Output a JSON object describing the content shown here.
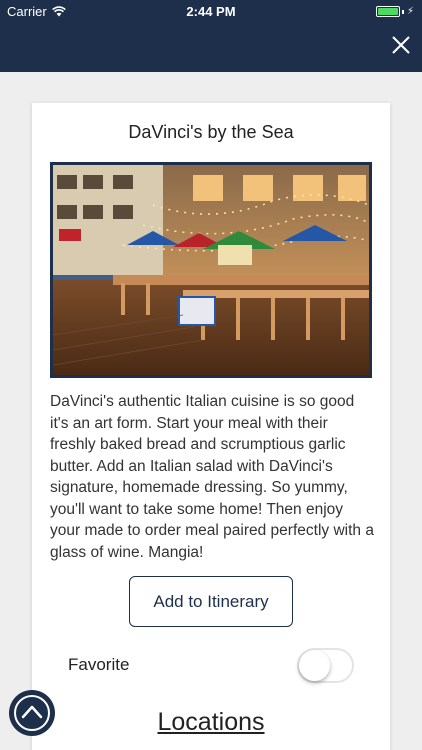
{
  "status_bar": {
    "carrier": "Carrier",
    "time": "2:44 PM",
    "icons": [
      "wifi-icon",
      "battery-icon",
      "charging-icon"
    ],
    "battery_color": "#4cd964"
  },
  "header": {
    "background": "#1d2f4b",
    "close_icon": "close-icon"
  },
  "detail": {
    "title": "DaVinci's by the Sea",
    "image_alt": "DaVinci's outdoor boardwalk patio with umbrellas and string lights",
    "description": "DaVinci's authentic Italian cuisine is so good it's an art form. Start your meal with their freshly baked bread and scrumptious garlic butter. Add an Italian salad with DaVinci's signature, homemade dressing. So yummy, you'll want to take some home! Then enjoy your made to order meal paired perfectly with a glass of wine. Mangia!",
    "itinerary_button": "Add to Itinerary",
    "favorite_label": "Favorite",
    "favorite_on": false,
    "locations_heading": "Locations"
  },
  "scroll_top_icon": "chevron-up-icon"
}
